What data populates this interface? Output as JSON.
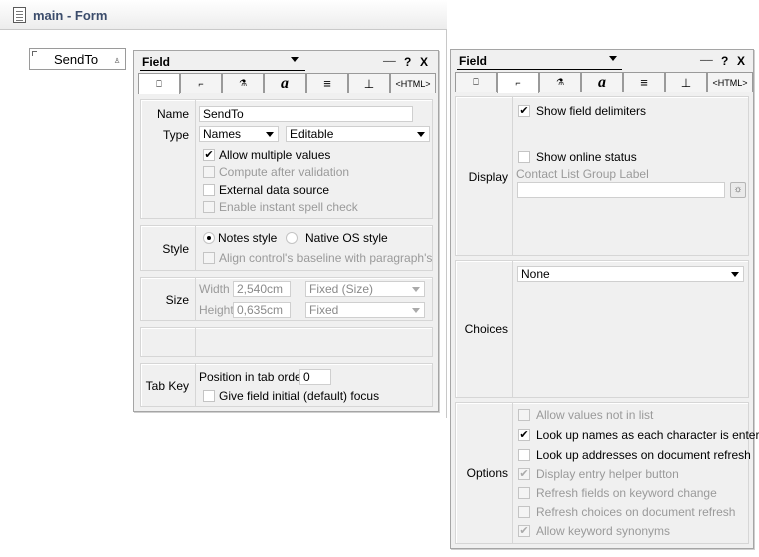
{
  "form": {
    "title": "main - Form",
    "field_label": "SendTo"
  },
  "left_panel": {
    "title": "Field",
    "controls": [
      "──",
      "?",
      "X"
    ],
    "tabs": [
      "⎕",
      "⌐",
      "⚗",
      "a",
      "≡",
      "⊥",
      "<HTML>"
    ],
    "basics": {
      "name_label": "Name",
      "name_value": "SendTo",
      "type_label": "Type",
      "type_value": "Names",
      "type_mode": "Editable",
      "allow_multiple": "Allow multiple values",
      "compute_after": "Compute after validation",
      "external_source": "External data source",
      "spell_check": "Enable instant spell check"
    },
    "style": {
      "label": "Style",
      "notes_style": "Notes style",
      "native_style": "Native OS style",
      "align_baseline": "Align control's baseline with paragraph's"
    },
    "size": {
      "label": "Size",
      "width_label": "Width",
      "width_value": "2,540cm",
      "width_mode": "Fixed (Size)",
      "height_label": "Height",
      "height_value": "0,635cm",
      "height_mode": "Fixed"
    },
    "tabkey": {
      "label": "Tab Key",
      "position_label": "Position in tab order",
      "position_value": "0",
      "initial_focus": "Give field initial (default) focus"
    }
  },
  "right_panel": {
    "title": "Field",
    "controls": [
      "──",
      "?",
      "X"
    ],
    "tabs": [
      "⎕",
      "⌐",
      "⚗",
      "a",
      "≡",
      "⊥",
      "<HTML>"
    ],
    "display": {
      "label": "Display",
      "show_delimiters": "Show field delimiters",
      "show_online": "Show online status",
      "contact_group_label": "Contact List Group Label"
    },
    "choices": {
      "label": "Choices",
      "value": "None"
    },
    "options": {
      "label": "Options",
      "allow_not_in_list": "Allow values not in list",
      "lookup_each_char": "Look up names as each character is entered",
      "lookup_refresh": "Look up addresses on document refresh",
      "entry_helper": "Display entry helper button",
      "refresh_fields": "Refresh fields on keyword change",
      "refresh_choices": "Refresh choices on document refresh",
      "allow_synonyms": "Allow keyword synonyms"
    }
  }
}
